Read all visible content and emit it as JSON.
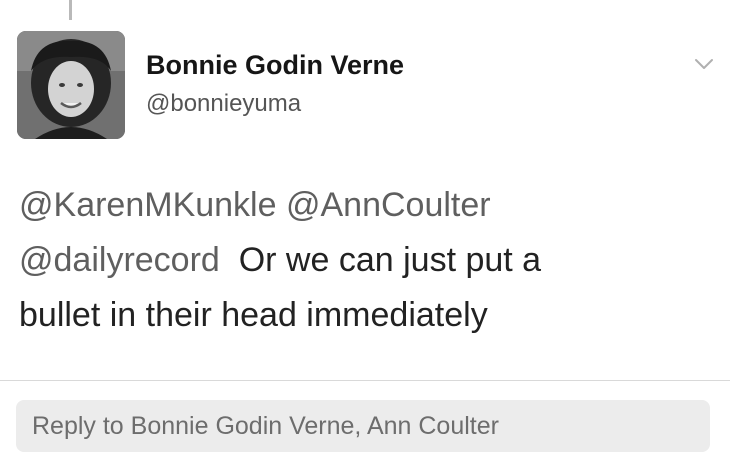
{
  "tweet": {
    "author": {
      "display_name": "Bonnie Godin Verne",
      "handle": "@bonnieyuma",
      "avatar_icon": "profile-photo"
    },
    "menu_icon": "chevron-down-icon",
    "body": {
      "mentions_line1": [
        "@KarenMKunkle",
        "@AnnCoulter"
      ],
      "mentions_line2": [
        "@dailyrecord"
      ],
      "text_line2": "Or we can just put a",
      "text_line3": "bullet in their head immediately"
    }
  },
  "reply": {
    "placeholder": "Reply to Bonnie Godin Verne, Ann Coulter"
  }
}
